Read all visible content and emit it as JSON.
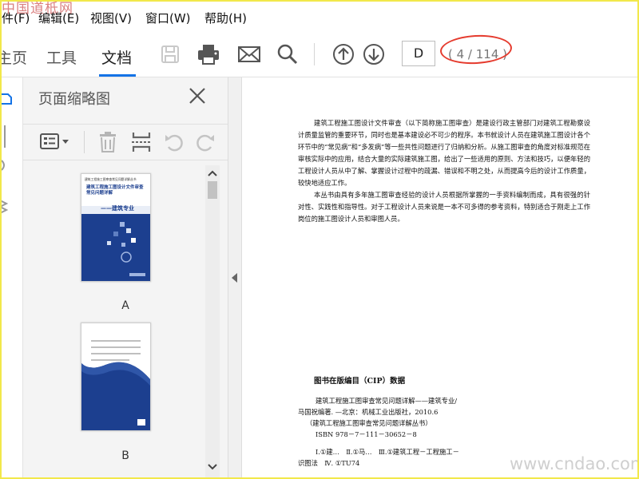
{
  "watermark": {
    "top": "中国道柢网",
    "bottom": "www.cndao.com"
  },
  "menu": [
    "件(F)",
    "编辑(E)",
    "视图(V)",
    "窗口(W)",
    "帮助(H)"
  ],
  "tabs": {
    "home": "主页",
    "tools": "工具",
    "document": "文档"
  },
  "toolbar_icons": [
    "save-icon",
    "print-icon",
    "mail-icon",
    "search-icon",
    "page-up-icon",
    "page-down-icon"
  ],
  "page_nav": {
    "current": "D",
    "count": "( 4 / 114 )"
  },
  "panel": {
    "title": "页面缩略图"
  },
  "thumbnails": [
    {
      "label": "A",
      "cover_title_1": "建筑工程施工图审查常见问题详解丛书",
      "cover_title_2": "建筑工程施工图设计文件审查常见问题详解",
      "cover_title_3": "——建筑专业"
    },
    {
      "label": "B"
    }
  ],
  "document": {
    "para1": "建筑工程施工图设计文件审查（以下简称施工图审查）是建设行政主管部门对建筑工程勘察设计质量监管的重要环节，同时也是基本建设必不可少的程序。本书就设计人员在建筑施工图设计各个环节中的“常见病”和“多发病”等一些共性问题进行了归纳和分析。从施工图审查的角度对标准规范在审核实际中的应用，结合大量的实际建筑施工图，给出了一些适用的原则、方法和技巧，以便年轻的工程设计人员从中了解、掌握设计过程中的疏漏、错误和不明之处，从而提高今后的设计工作质量，较快地适应工作。",
    "para2": "本丛书由具有多年施工图审查经验的设计人员根据所掌握的一手资料编制而成，具有很强的针对性、实践性和指导性。对于工程设计人员来说是一本不可多得的参考资料，特别适合于刚走上工作岗位的施工图设计人员和审图人员。",
    "cip_title": "图书在版编目（CIP）数据",
    "cip_lines": [
      "建筑工程施工图审查常见问题详解——建筑专业/",
      "马国祝编著. —北京：机械工业出版社，2010.6",
      "（建筑工程施工图审查常见问题详解丛书）",
      "ISBN 978－7－111－30652－8",
      "",
      "Ⅰ.①建…　Ⅱ.①马…　Ⅲ.①建筑工程－工程施工－",
      "识图法　Ⅳ. ①TU74"
    ]
  },
  "colors": {
    "accent": "#1473e6",
    "annotation": "#e53b2e",
    "cover_blue": "#1c3f8f"
  }
}
